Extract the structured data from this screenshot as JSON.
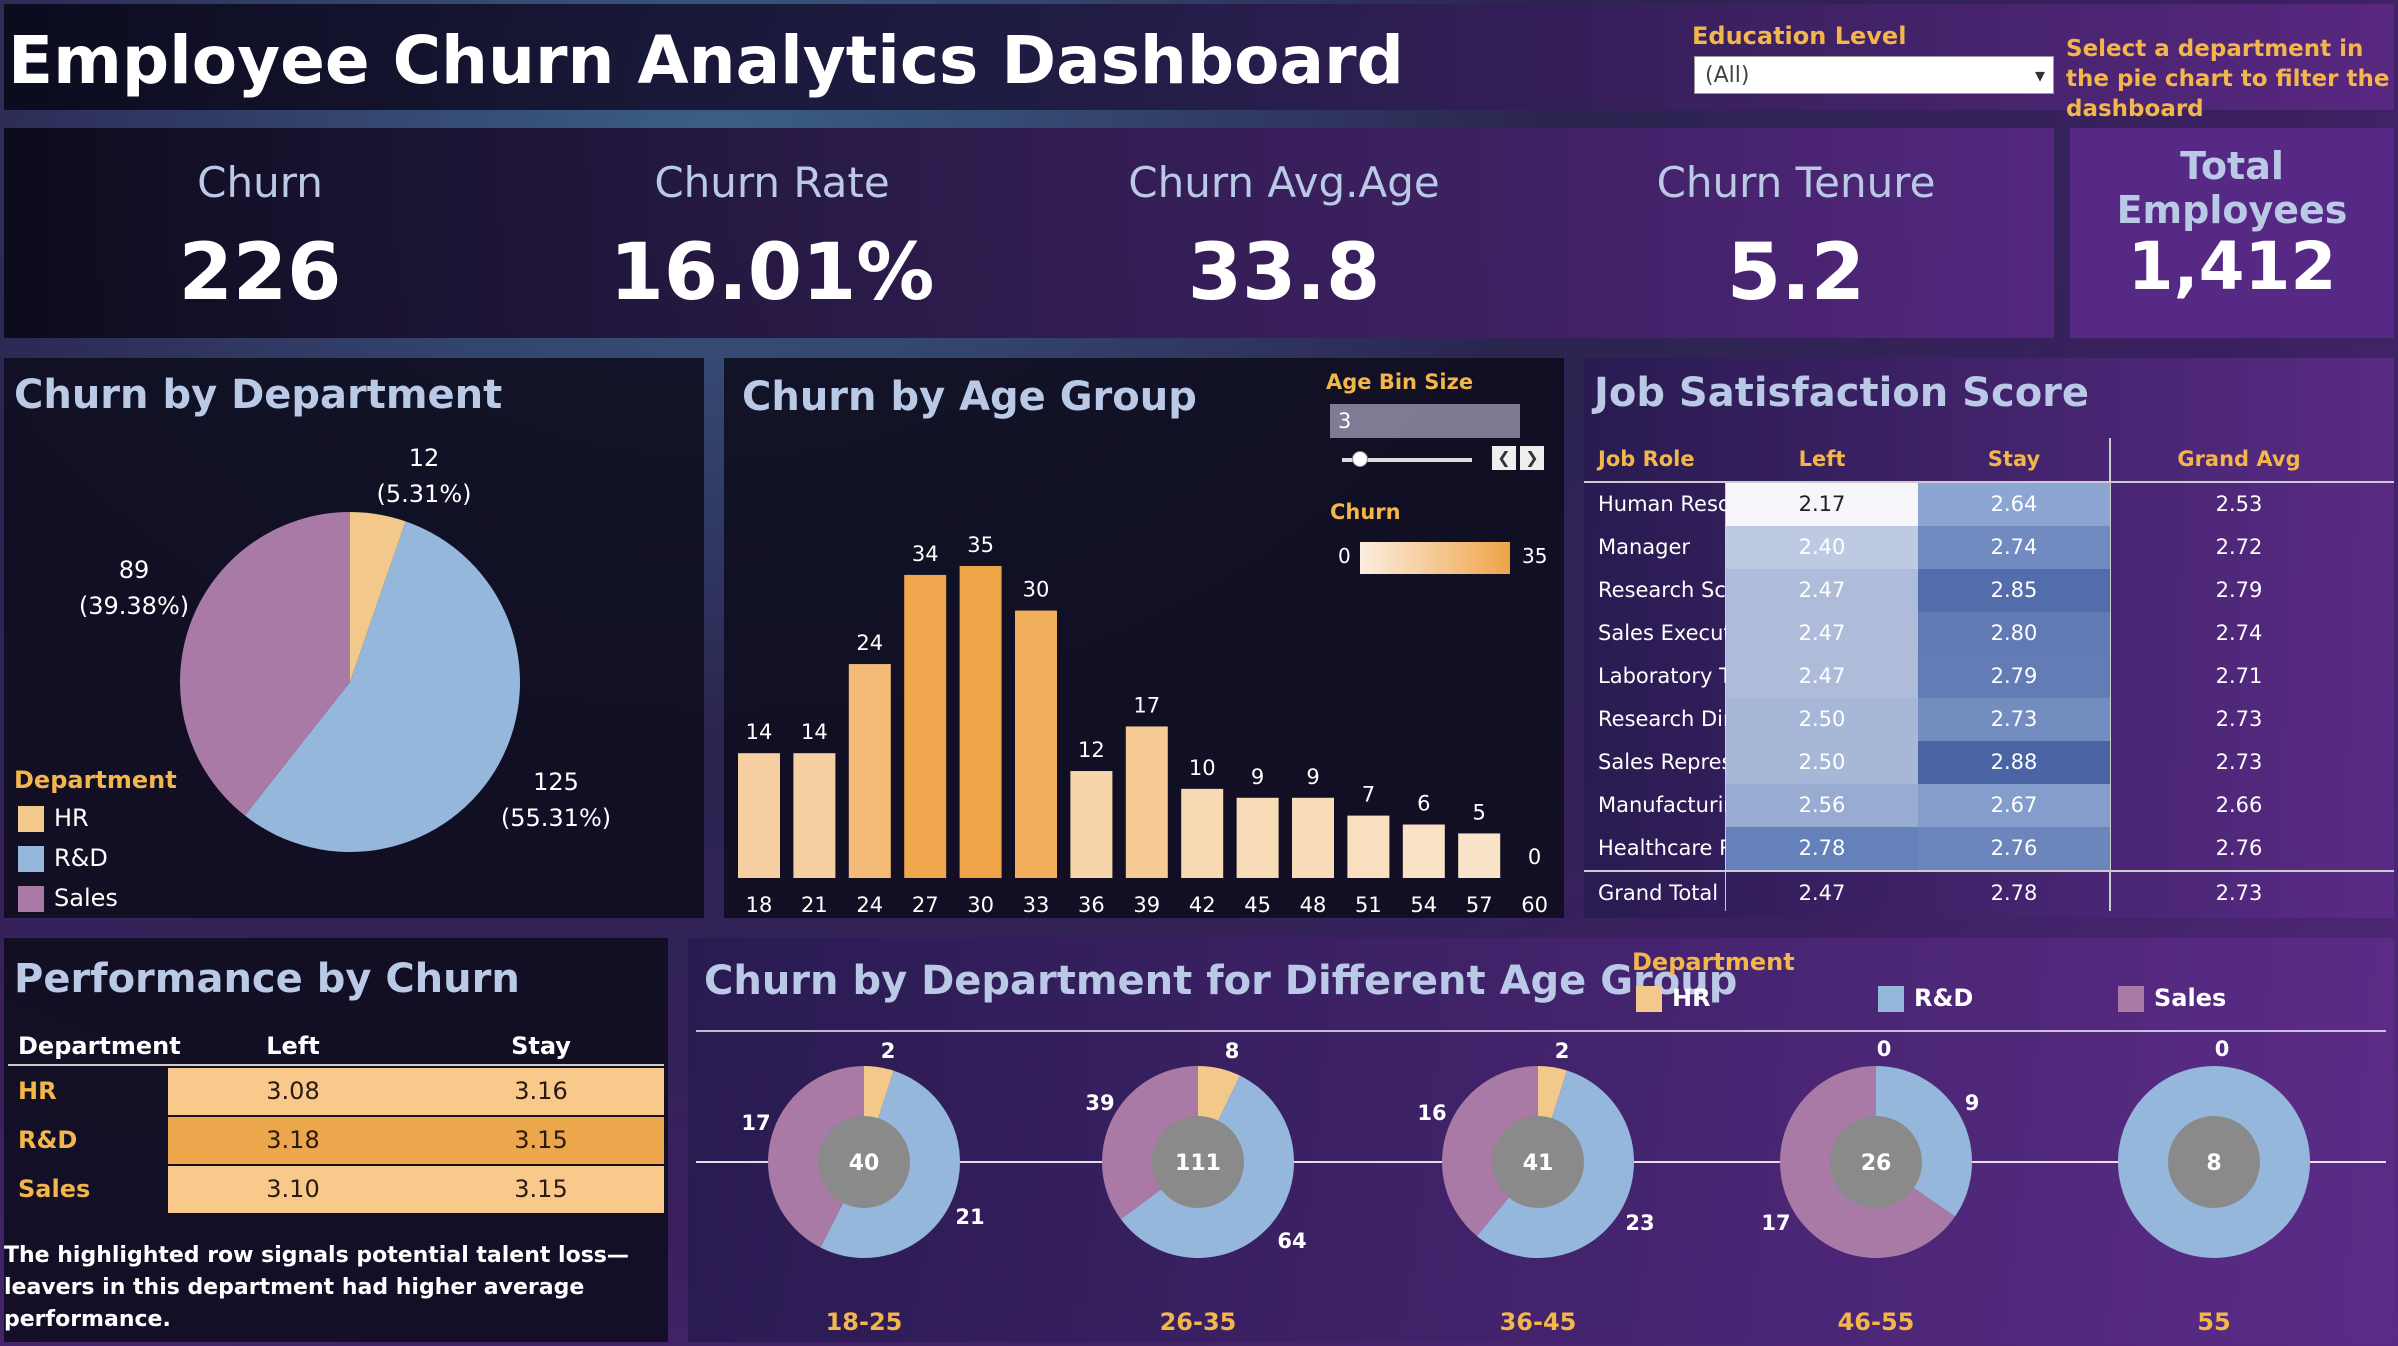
{
  "header": {
    "title": "Employee Churn Analytics Dashboard",
    "education_label": "Education Level",
    "education_value": "(All)",
    "hint": "Select a department in the pie chart to filter the dashboard"
  },
  "kpis": [
    {
      "label": "Churn",
      "value": "226"
    },
    {
      "label": "Churn Rate",
      "value": "16.01%"
    },
    {
      "label": "Churn Avg.Age",
      "value": "33.8"
    },
    {
      "label": "Churn Tenure",
      "value": "5.2"
    }
  ],
  "total": {
    "label": "Total Employees",
    "value": "1,412"
  },
  "dept_pie": {
    "title": "Churn by Department",
    "legend_title": "Department",
    "slices": [
      {
        "name": "HR",
        "value": 12,
        "pct": "(5.31%)",
        "color": "#f2c98a"
      },
      {
        "name": "R&D",
        "value": 125,
        "pct": "(55.31%)",
        "color": "#96b7dc"
      },
      {
        "name": "Sales",
        "value": 89,
        "pct": "(39.38%)",
        "color": "#a97aa6"
      }
    ]
  },
  "age_chart": {
    "title": "Churn by Age Group",
    "bin_label": "Age Bin Size",
    "bin_value": "3",
    "legend_title": "Churn",
    "legend_min": "0",
    "legend_max": "35"
  },
  "chart_data": {
    "type": "bar",
    "categories": [
      "18",
      "21",
      "24",
      "27",
      "30",
      "33",
      "36",
      "39",
      "42",
      "45",
      "48",
      "51",
      "54",
      "57",
      "60"
    ],
    "values": [
      14,
      14,
      24,
      34,
      35,
      30,
      12,
      17,
      10,
      9,
      9,
      7,
      6,
      5,
      0
    ],
    "title": "Churn by Age Group",
    "xlabel": "",
    "ylabel": "",
    "ylim": [
      0,
      35
    ],
    "color_scale": [
      "#fbeede",
      "#efa448"
    ]
  },
  "job": {
    "title": "Job Satisfaction Score",
    "headers": [
      "Job Role",
      "Left",
      "Stay",
      "Grand Avg"
    ],
    "rows": [
      {
        "role": "Human Resources",
        "left": "2.17",
        "stay": "2.64",
        "avg": "2.53"
      },
      {
        "role": "Manager",
        "left": "2.40",
        "stay": "2.74",
        "avg": "2.72"
      },
      {
        "role": "Research Scientist",
        "left": "2.47",
        "stay": "2.85",
        "avg": "2.79"
      },
      {
        "role": "Sales Executive",
        "left": "2.47",
        "stay": "2.80",
        "avg": "2.74"
      },
      {
        "role": "Laboratory Techni..",
        "left": "2.47",
        "stay": "2.79",
        "avg": "2.71"
      },
      {
        "role": "Research Director",
        "left": "2.50",
        "stay": "2.73",
        "avg": "2.73"
      },
      {
        "role": "Sales Representat..",
        "left": "2.50",
        "stay": "2.88",
        "avg": "2.73"
      },
      {
        "role": "Manufacturing Dir..",
        "left": "2.56",
        "stay": "2.67",
        "avg": "2.66"
      },
      {
        "role": "Healthcare Repres..",
        "left": "2.78",
        "stay": "2.76",
        "avg": "2.76"
      }
    ],
    "total": {
      "role": "Grand Total",
      "left": "2.47",
      "stay": "2.78",
      "avg": "2.73"
    }
  },
  "perf": {
    "title": "Performance by Churn",
    "headers": [
      "Department",
      "Left",
      "Stay"
    ],
    "rows": [
      {
        "dept": "HR",
        "left": "3.08",
        "stay": "3.16"
      },
      {
        "dept": "R&D",
        "left": "3.18",
        "stay": "3.15"
      },
      {
        "dept": "Sales",
        "left": "3.10",
        "stay": "3.15"
      }
    ],
    "note": "The highlighted row signals potential talent loss—leavers in this department had higher average performance."
  },
  "combo": {
    "title": "Churn by Department for Different Age Group",
    "legend_title": "Department",
    "legend": [
      {
        "name": "HR",
        "color": "#f2c98a"
      },
      {
        "name": "R&D",
        "color": "#96b7dc"
      },
      {
        "name": "Sales",
        "color": "#a97aa6"
      }
    ],
    "groups": [
      {
        "label": "18-25",
        "total": "40",
        "hr": 2,
        "rd": 21,
        "sales": 17
      },
      {
        "label": "26-35",
        "total": "111",
        "hr": 8,
        "rd": 64,
        "sales": 39
      },
      {
        "label": "36-45",
        "total": "41",
        "hr": 2,
        "rd": 23,
        "sales": 16
      },
      {
        "label": "46-55",
        "total": "26",
        "hr": 0,
        "rd": 9,
        "sales": 17
      },
      {
        "label": "55",
        "total": "8",
        "hr": 0,
        "rd": 8,
        "sales": 0
      }
    ]
  }
}
